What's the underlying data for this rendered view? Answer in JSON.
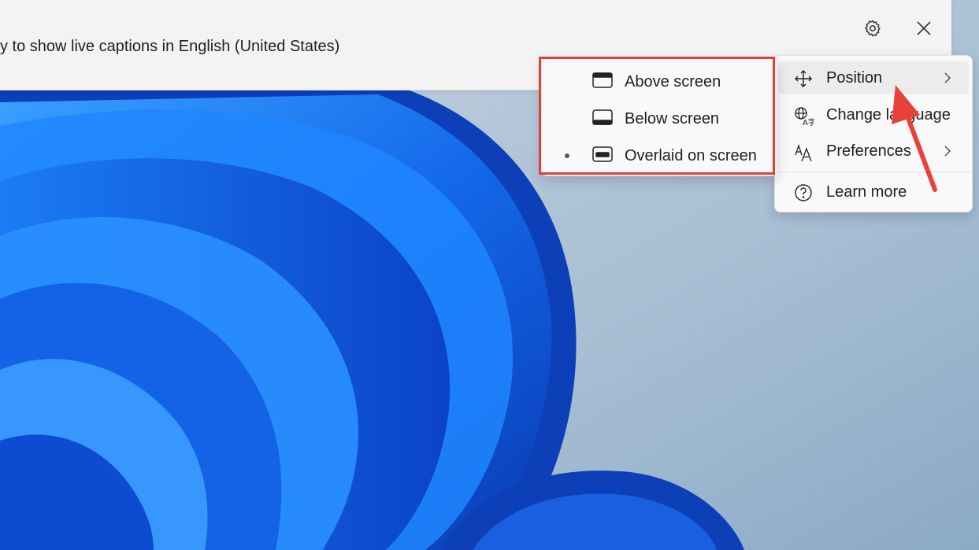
{
  "caption_bar": {
    "text": "y to show live captions in English (United States)",
    "settings_icon": "gear-icon",
    "close_icon": "close-icon"
  },
  "menu": {
    "items": [
      {
        "label": "Position",
        "icon": "move-arrows-icon",
        "has_submenu": true,
        "active": true
      },
      {
        "label": "Change language",
        "icon": "language-icon",
        "has_submenu": false
      },
      {
        "label": "Preferences",
        "icon": "text-size-icon",
        "has_submenu": true
      },
      {
        "label": "Learn more",
        "icon": "help-icon",
        "has_submenu": false
      }
    ]
  },
  "position_submenu": {
    "items": [
      {
        "label": "Above screen",
        "icon": "window-top-bar-icon",
        "selected": false
      },
      {
        "label": "Below screen",
        "icon": "window-bottom-bar-icon",
        "selected": false
      },
      {
        "label": "Overlaid on screen",
        "icon": "window-overlay-bar-icon",
        "selected": true
      }
    ]
  },
  "colors": {
    "highlight_outline": "#e0403a",
    "arrow": "#e8403a",
    "menu_bg": "#f9f9f9",
    "wallpaper_blue": "#1a5fe0"
  }
}
